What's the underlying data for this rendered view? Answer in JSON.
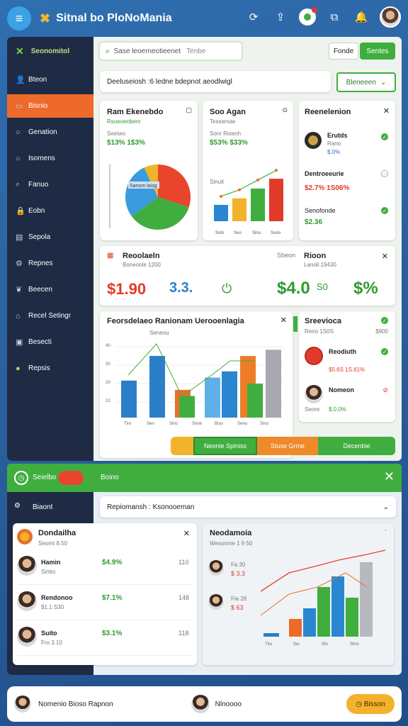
{
  "app": {
    "title": "Sitnal bo PloNoMania"
  },
  "topbar": {
    "icons": [
      "menu-icon",
      "logo-icon",
      "refresh-icon",
      "upload-icon",
      "status-icon",
      "window-icon",
      "bell-icon",
      "avatar"
    ]
  },
  "sidebar": {
    "header": "Seonomitol",
    "items": [
      {
        "label": "Bteon",
        "icon": "user-icon"
      },
      {
        "label": "Bisnio",
        "icon": "card-icon",
        "active": true
      },
      {
        "label": "Genation",
        "icon": "circle-icon"
      },
      {
        "label": "Isomens",
        "icon": "circle-icon"
      },
      {
        "label": "Fanuo",
        "icon": "search-icon"
      },
      {
        "label": "Eobn",
        "icon": "lock-icon"
      },
      {
        "label": "Sepola",
        "icon": "doc-icon"
      },
      {
        "label": "Repnes",
        "icon": "gear-icon"
      },
      {
        "label": "Beecen",
        "icon": "leaf-icon"
      },
      {
        "label": "Recel Setingr",
        "icon": "home-icon"
      },
      {
        "label": "Besecti",
        "icon": "monitor-icon"
      },
      {
        "label": "Repsis",
        "icon": "dot-icon"
      }
    ]
  },
  "header": {
    "search_placeholder": "Sase leoerneotieenet",
    "search_hint": "Tenbe",
    "btn1": "Fonde",
    "btn2": "Sentes"
  },
  "filter": {
    "text": "Deeluseiosh :6 ledne bdepnot aeodlwigl",
    "dropdown": "Bleneeen"
  },
  "card_pie": {
    "title": "Ram Ekenebdo",
    "sub": "Rsoeoenbem",
    "label": "Seeiwo",
    "value": "$13% 1$3%",
    "pie_label": "Sanom lsiog"
  },
  "card_bar": {
    "title": "Soo Agan",
    "sub": "Tessemae",
    "label": "Sonr Risenh",
    "value": "$53% $33%",
    "axis_label": "Sinuit",
    "x_labels": [
      "Soto",
      "Suo",
      "Sinu",
      "Suno"
    ]
  },
  "card_list": {
    "title": "Reenelenion",
    "items": [
      {
        "name": "Erutds",
        "sub": "Rano",
        "value": "$.0%"
      },
      {
        "name": "Dentroeeurie",
        "sub": "",
        "value": "$2.7% 1S06%"
      },
      {
        "name": "Senofonde",
        "sub": "",
        "value": "$2.36"
      }
    ]
  },
  "kpi": {
    "title": "Reoolaeln",
    "sub": "Boneoole 1200",
    "v1": "$1.90",
    "v2": "3.3.",
    "right_title": "Rioon",
    "right_label": "Sbeon",
    "right_sub": "Lanoli 19430",
    "v3": "$4.0",
    "v3b": "S0",
    "v4": "$%"
  },
  "big_chart": {
    "title": "Feorsdelaeo Ranionam Uerooenlagia",
    "legend": "Seneou"
  },
  "tabs": [
    {
      "label": "Neonie Spiniss"
    },
    {
      "label": "Stuse Grme"
    },
    {
      "label": "Decenbie"
    }
  ],
  "card_right": {
    "title": "Sreevioca",
    "sub": "Reno 1S0S",
    "amount": "$900",
    "items": [
      {
        "name": "Reodiuth",
        "value": "$5.6S 1S.61%"
      },
      {
        "name": "Nomeon",
        "value": "$.0.0%",
        "sub": "Seore"
      }
    ]
  },
  "panel2": {
    "left": "Seielbo",
    "right": "Boino",
    "side_label": "Biaont",
    "search": "Repiomansh : Ksonooeman"
  },
  "list2": {
    "title": "Dondailha",
    "sub": "Seomt 8.50",
    "rows": [
      {
        "name": "Hamin",
        "sub": "Sintio",
        "value": "$4.9%",
        "num": "110"
      },
      {
        "name": "Rendonoo",
        "sub": "$1.1 S30",
        "value": "$7.1%",
        "num": "148"
      },
      {
        "name": "Suito",
        "sub": "Fro 3.10",
        "value": "$3.1%",
        "num": "118"
      }
    ]
  },
  "chart2": {
    "title": "Neodamoia",
    "sub": "Wesonme 1 9 50",
    "labels": [
      "Fa 30",
      "Fia 28"
    ],
    "vals": [
      "$ 3.3",
      "$ 63"
    ],
    "x_labels": [
      "Tiro",
      "Sei",
      "Sfu",
      "Shro"
    ]
  },
  "bottom": {
    "name": "Nomenio Bioso Rapnon",
    "middle": "Nlnoooo",
    "btn": "Bisson"
  },
  "colors": {
    "accent": "#ee6a2a",
    "green": "#3fae3f",
    "dark": "#1f2a45",
    "blue": "#2a78c0"
  },
  "chart_data": [
    {
      "type": "pie",
      "values": [
        30,
        35,
        28,
        7
      ],
      "colors": [
        "#e8452c",
        "#3fae3f",
        "#3a9be0",
        "#f0b32e"
      ]
    },
    {
      "type": "bar",
      "categories": [
        "Soto",
        "Suo",
        "Sinu",
        "Suno"
      ],
      "values": [
        25,
        35,
        50,
        65
      ],
      "colors": [
        "#2a86d0",
        "#f2b22c",
        "#3fae3f",
        "#e23a2a"
      ]
    },
    {
      "type": "bar",
      "values": [
        60,
        100,
        45,
        35,
        65,
        75,
        100,
        55,
        110
      ],
      "colors": [
        "#2a7fc8",
        "#2a7fc8",
        "#e8702c",
        "#3fae3f",
        "#5fb0e6",
        "#2a86d0",
        "#ee7d2a",
        "#3fae3f",
        "#a8a8b0"
      ],
      "ylabels": [
        "40",
        "30",
        "20",
        "10"
      ],
      "x_labels": [
        "Tiro",
        "Sen",
        "Sino",
        "Snoe",
        "Biso",
        "Seno",
        "Sino"
      ]
    },
    {
      "type": "bar",
      "values": [
        5,
        25,
        40,
        70,
        85,
        55,
        105
      ],
      "colors": [
        "#2a7fc8",
        "#ee6a2a",
        "#2a86d0",
        "#3fae3f",
        "#2a86d0",
        "#3fae3f",
        "#b8b8c0"
      ]
    }
  ]
}
